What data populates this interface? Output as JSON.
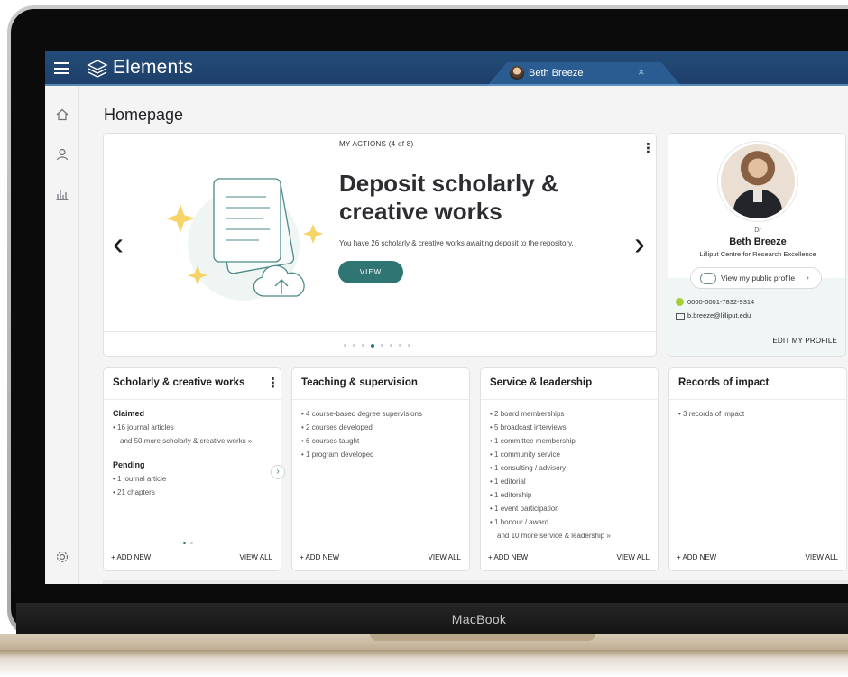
{
  "app": {
    "brand": "Elements",
    "user_tab": "Beth Breeze",
    "close_glyph": "×"
  },
  "nav": {
    "icons": [
      "home-icon",
      "person-icon",
      "bar-chart-icon",
      "settings-icon"
    ]
  },
  "page": {
    "title": "Homepage"
  },
  "actions": {
    "label": "MY ACTIONS (4 of 8)",
    "title": "Deposit scholarly & creative works",
    "text": "You have 26 scholarly & creative works awaiting deposit to the repository.",
    "button": "VIEW",
    "total_dots": 8,
    "active_dot": 4
  },
  "profile": {
    "title": "Dr",
    "name": "Beth Breeze",
    "dept": "Lilliput Centre for Research Excellence",
    "public_button": "View my public profile",
    "chevron": "›",
    "orcid": "0000-0001-7832-9314",
    "email": "b.breeze@lilliput.edu",
    "edit": "EDIT MY PROFILE"
  },
  "tiles": {
    "scholarly": {
      "title": "Scholarly & creative works",
      "claimed_heading": "Claimed",
      "claimed_items": [
        "• 16 journal articles"
      ],
      "claimed_more": "and 50 more scholarly & creative works »",
      "pending_heading": "Pending",
      "pending_items": [
        "• 1 journal article",
        "• 21 chapters"
      ]
    },
    "teaching": {
      "title": "Teaching & supervision",
      "items": [
        "• 4 course-based degree supervisions",
        "• 2 courses developed",
        "• 6 courses taught",
        "• 1 program developed"
      ]
    },
    "service": {
      "title": "Service & leadership",
      "items": [
        "• 2 board memberships",
        "• 5 broadcast interviews",
        "• 1 committee membership",
        "• 1 community service",
        "• 1 consulting / advisory",
        "• 1 editorial",
        "• 1 editorship",
        "• 1 event participation",
        "• 1 honour / award"
      ],
      "more": "and 10 more service & leadership »"
    },
    "impact": {
      "title": "Records of impact",
      "items": [
        "• 3 records of impact"
      ]
    },
    "add_new": "+ ADD NEW",
    "view_all": "VIEW ALL"
  },
  "device": {
    "label": "MacBook"
  },
  "colors": {
    "topbar": "#1d3f69",
    "accent": "#2f7573",
    "orcid": "#a6ce39"
  }
}
